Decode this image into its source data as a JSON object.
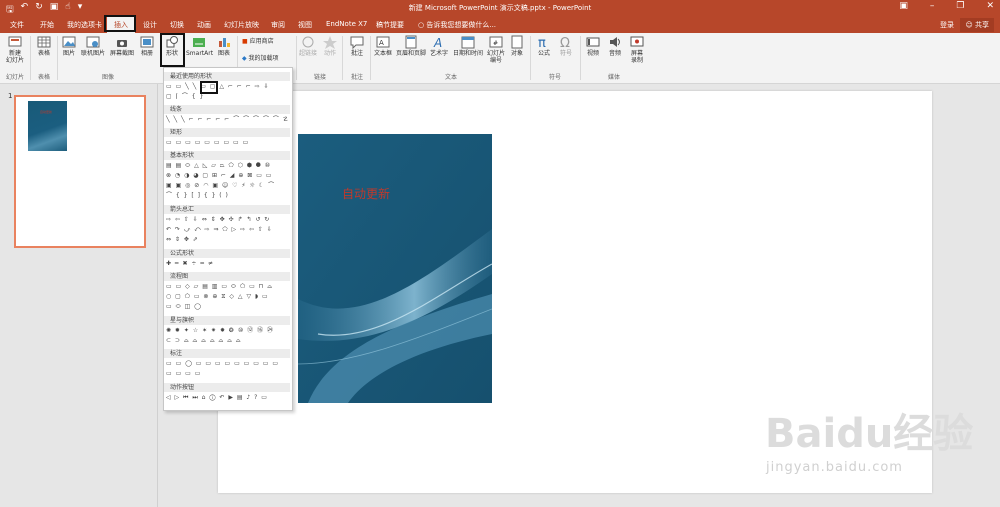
{
  "titlebar": {
    "title": "新建 Microsoft PowerPoint 演示文稿.pptx - PowerPoint",
    "qat_icons": [
      "save-icon",
      "undo-icon",
      "redo-icon",
      "present-icon",
      "touch-icon"
    ],
    "win_icons": [
      "ribbon-display-icon",
      "minimize-icon",
      "restore-icon",
      "close-icon"
    ]
  },
  "tabs": [
    "文件",
    "开始",
    "我的选项卡",
    "插入",
    "设计",
    "切换",
    "动画",
    "幻灯片放映",
    "审阅",
    "视图",
    "EndNote X7",
    "稿节提要"
  ],
  "active_tab": "插入",
  "tellme": "告诉我您想要做什么...",
  "login": "登录",
  "share": "共享",
  "ribbon": {
    "buttons": [
      "新建\n幻灯片",
      "表格",
      "图片",
      "联机图片",
      "屏幕截图",
      "相册",
      "形状",
      "SmartArt",
      "图表",
      "应用商店",
      "我的加载项",
      "超链接",
      "动作",
      "批注",
      "文本框",
      "页眉和页脚",
      "艺术字",
      "日期和时间",
      "幻灯片\n编号",
      "对象",
      "公式",
      "符号",
      "视频",
      "音频",
      "屏幕\n录制"
    ],
    "groups": [
      "幻灯片",
      "表格",
      "图像",
      "链接",
      "批注",
      "文本",
      "符号",
      "媒体"
    ]
  },
  "thumbnail": {
    "number": "1"
  },
  "slide": {
    "text": "自动更新"
  },
  "shapes_menu": {
    "sections": [
      "最近使用的形状",
      "线条",
      "矩形",
      "基本形状",
      "箭头总汇",
      "公式形状",
      "流程图",
      "星与旗帜",
      "标注",
      "动作按钮"
    ]
  },
  "watermark": {
    "line1": "Baidu经验",
    "line2": "jingyan.baidu.com"
  }
}
